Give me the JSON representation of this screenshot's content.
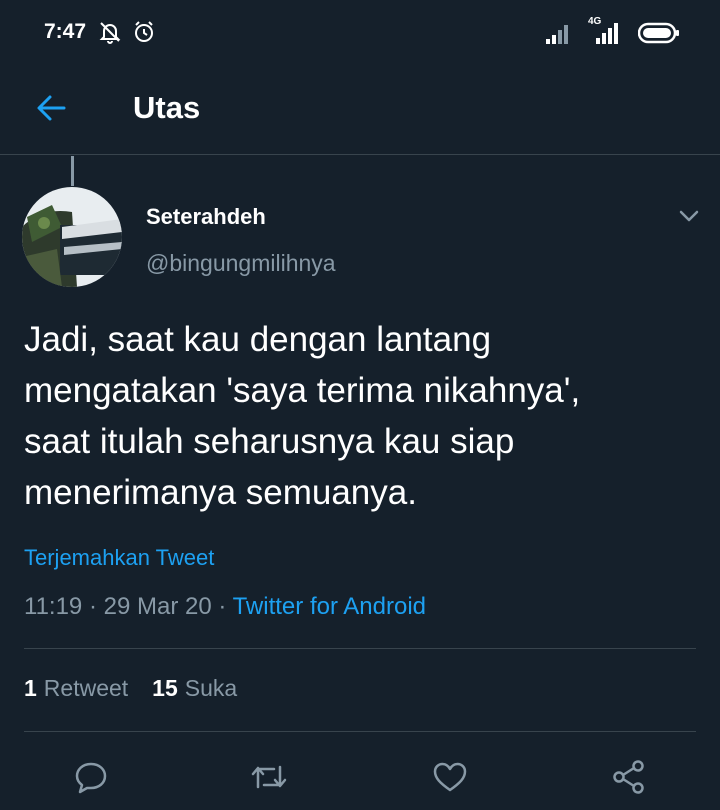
{
  "status_bar": {
    "time": "7:47",
    "left_icons": [
      "notifications-off-icon",
      "alarm-icon"
    ],
    "right_icons": [
      "signal-icon",
      "signal-4g-icon",
      "battery-icon"
    ],
    "network_label": "4G"
  },
  "header": {
    "back_icon": "arrow-left-icon",
    "title": "Utas"
  },
  "tweet": {
    "author": {
      "display_name": "Seterahdeh",
      "handle": "@bingungmilihnya"
    },
    "text": "Jadi, saat kau dengan lantang\nmengatakan 'saya terima nikahnya',\nsaat itulah seharusnya kau siap\nmenerimanya semuanya.",
    "translate_label": "Terjemahkan Tweet",
    "time": "11:19",
    "date": "29 Mar 20",
    "separator": "·",
    "source": "Twitter for Android",
    "stats": {
      "retweet_count": "1",
      "retweet_label": "Retweet",
      "like_count": "15",
      "like_label": "Suka"
    }
  },
  "actions": [
    "reply-icon",
    "retweet-icon",
    "like-icon",
    "share-icon"
  ],
  "colors": {
    "background": "#15202b",
    "accent": "#1da1f2",
    "secondary_text": "#8899a6",
    "divider": "#38444d"
  }
}
